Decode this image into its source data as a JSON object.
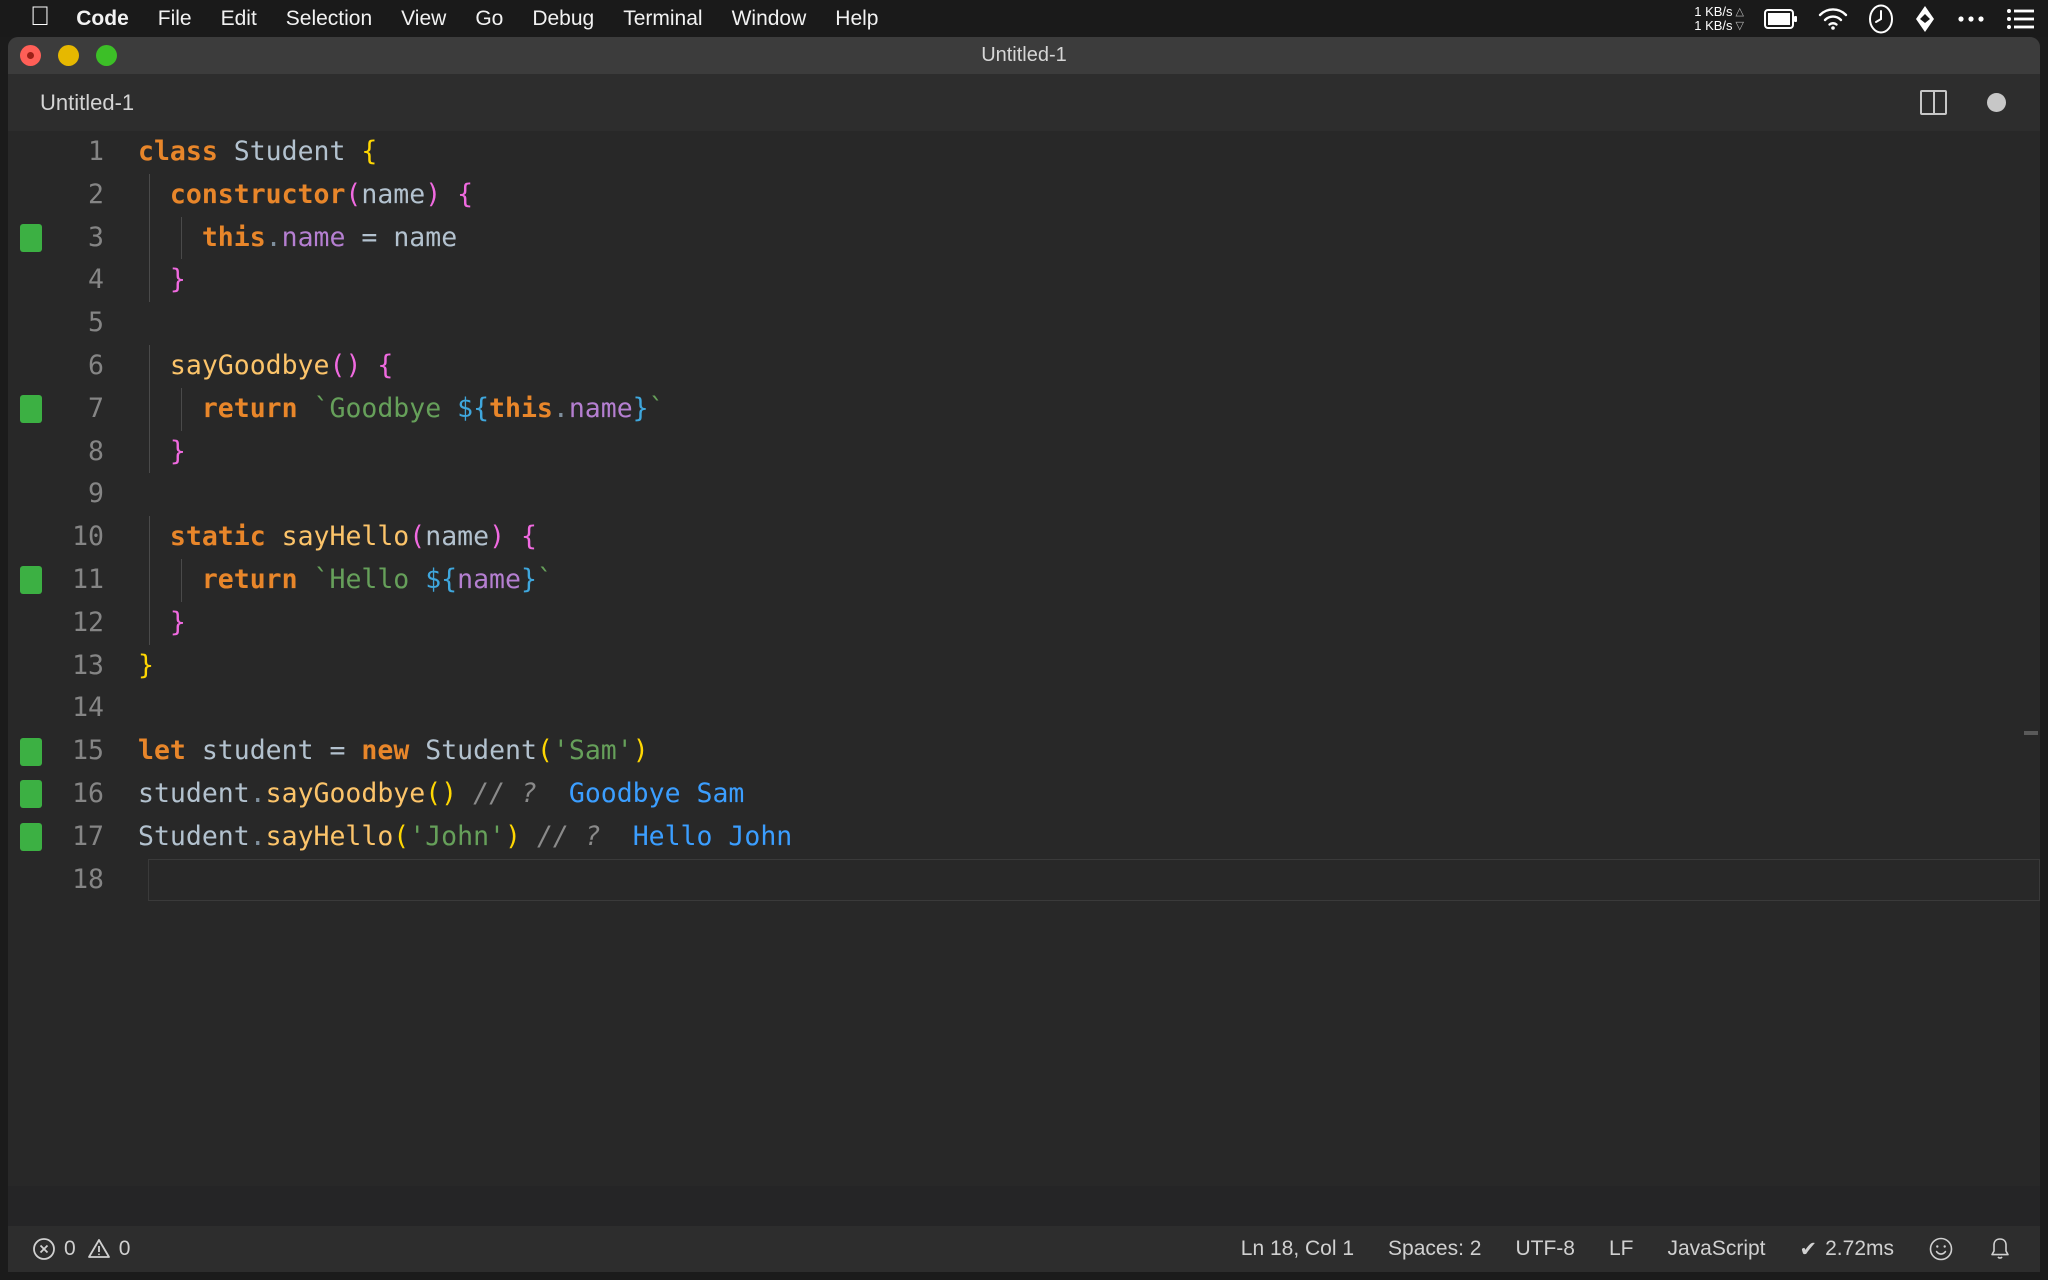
{
  "menubar": {
    "apple_icon": "apple-logo-icon",
    "items": [
      {
        "label": "Code",
        "bold": true
      },
      {
        "label": "File",
        "bold": false
      },
      {
        "label": "Edit",
        "bold": false
      },
      {
        "label": "Selection",
        "bold": false
      },
      {
        "label": "View",
        "bold": false
      },
      {
        "label": "Go",
        "bold": false
      },
      {
        "label": "Debug",
        "bold": false
      },
      {
        "label": "Terminal",
        "bold": false
      },
      {
        "label": "Window",
        "bold": false
      },
      {
        "label": "Help",
        "bold": false
      }
    ],
    "status": {
      "net_up": "1 KB/s",
      "net_down": "1 KB/s",
      "up_arrow": "△",
      "down_arrow": "▽",
      "icons": [
        "battery-icon",
        "wifi-icon",
        "clock-icon",
        "dropbox-icon",
        "control-center-icon",
        "list-icon"
      ]
    }
  },
  "window": {
    "title": "Untitled-1",
    "traffic_lights": [
      "close-button",
      "minimize-button",
      "zoom-button"
    ]
  },
  "tab": {
    "label": "Untitled-1",
    "split_icon": "split-editor-icon",
    "dirty_icon": "unsaved-changes-dot"
  },
  "editor": {
    "lines": [
      {
        "n": "1",
        "git": false,
        "indent": 0,
        "tokens": [
          {
            "t": "class",
            "c": "kw"
          },
          {
            "t": " ",
            "c": "op"
          },
          {
            "t": "Student",
            "c": "ident"
          },
          {
            "t": " ",
            "c": "op"
          },
          {
            "t": "{",
            "c": "br-y"
          }
        ]
      },
      {
        "n": "2",
        "git": false,
        "indent": 1,
        "tokens": [
          {
            "t": "  ",
            "c": "op"
          },
          {
            "t": "constructor",
            "c": "kw"
          },
          {
            "t": "(",
            "c": "br-p"
          },
          {
            "t": "name",
            "c": "ident"
          },
          {
            "t": ")",
            "c": "br-p"
          },
          {
            "t": " ",
            "c": "op"
          },
          {
            "t": "{",
            "c": "br-p"
          }
        ]
      },
      {
        "n": "3",
        "git": true,
        "indent": 2,
        "tokens": [
          {
            "t": "    ",
            "c": "op"
          },
          {
            "t": "this",
            "c": "kw"
          },
          {
            "t": ".",
            "c": "dot"
          },
          {
            "t": "name",
            "c": "prop"
          },
          {
            "t": " = ",
            "c": "op"
          },
          {
            "t": "name",
            "c": "ident"
          }
        ]
      },
      {
        "n": "4",
        "git": false,
        "indent": 1,
        "tokens": [
          {
            "t": "  ",
            "c": "op"
          },
          {
            "t": "}",
            "c": "br-p"
          }
        ]
      },
      {
        "n": "5",
        "git": false,
        "indent": 0,
        "tokens": []
      },
      {
        "n": "6",
        "git": false,
        "indent": 1,
        "tokens": [
          {
            "t": "  ",
            "c": "op"
          },
          {
            "t": "sayGoodbye",
            "c": "fn"
          },
          {
            "t": "(",
            "c": "br-p"
          },
          {
            "t": ")",
            "c": "br-p"
          },
          {
            "t": " ",
            "c": "op"
          },
          {
            "t": "{",
            "c": "br-p"
          }
        ]
      },
      {
        "n": "7",
        "git": true,
        "indent": 2,
        "tokens": [
          {
            "t": "    ",
            "c": "op"
          },
          {
            "t": "return",
            "c": "kw"
          },
          {
            "t": " ",
            "c": "op"
          },
          {
            "t": "`Goodbye ",
            "c": "tpl"
          },
          {
            "t": "${",
            "c": "interp"
          },
          {
            "t": "this",
            "c": "kw"
          },
          {
            "t": ".",
            "c": "dot"
          },
          {
            "t": "name",
            "c": "prop"
          },
          {
            "t": "}",
            "c": "interp"
          },
          {
            "t": "`",
            "c": "tpl"
          }
        ]
      },
      {
        "n": "8",
        "git": false,
        "indent": 1,
        "tokens": [
          {
            "t": "  ",
            "c": "op"
          },
          {
            "t": "}",
            "c": "br-p"
          }
        ]
      },
      {
        "n": "9",
        "git": false,
        "indent": 0,
        "tokens": []
      },
      {
        "n": "10",
        "git": false,
        "indent": 1,
        "tokens": [
          {
            "t": "  ",
            "c": "op"
          },
          {
            "t": "static",
            "c": "kw"
          },
          {
            "t": " ",
            "c": "op"
          },
          {
            "t": "sayHello",
            "c": "fn"
          },
          {
            "t": "(",
            "c": "br-p"
          },
          {
            "t": "name",
            "c": "ident"
          },
          {
            "t": ")",
            "c": "br-p"
          },
          {
            "t": " ",
            "c": "op"
          },
          {
            "t": "{",
            "c": "br-p"
          }
        ]
      },
      {
        "n": "11",
        "git": true,
        "indent": 2,
        "tokens": [
          {
            "t": "    ",
            "c": "op"
          },
          {
            "t": "return",
            "c": "kw"
          },
          {
            "t": " ",
            "c": "op"
          },
          {
            "t": "`Hello ",
            "c": "tpl"
          },
          {
            "t": "${",
            "c": "interp"
          },
          {
            "t": "name",
            "c": "prop"
          },
          {
            "t": "}",
            "c": "interp"
          },
          {
            "t": "`",
            "c": "tpl"
          }
        ]
      },
      {
        "n": "12",
        "git": false,
        "indent": 1,
        "tokens": [
          {
            "t": "  ",
            "c": "op"
          },
          {
            "t": "}",
            "c": "br-p"
          }
        ]
      },
      {
        "n": "13",
        "git": false,
        "indent": 0,
        "tokens": [
          {
            "t": "}",
            "c": "br-y"
          }
        ]
      },
      {
        "n": "14",
        "git": false,
        "indent": 0,
        "tokens": []
      },
      {
        "n": "15",
        "git": true,
        "indent": 0,
        "tokens": [
          {
            "t": "let",
            "c": "kw"
          },
          {
            "t": " ",
            "c": "op"
          },
          {
            "t": "student",
            "c": "ident"
          },
          {
            "t": " = ",
            "c": "op"
          },
          {
            "t": "new",
            "c": "kw"
          },
          {
            "t": " ",
            "c": "op"
          },
          {
            "t": "Student",
            "c": "ident"
          },
          {
            "t": "(",
            "c": "br-y"
          },
          {
            "t": "'Sam'",
            "c": "str"
          },
          {
            "t": ")",
            "c": "br-y"
          }
        ]
      },
      {
        "n": "16",
        "git": true,
        "indent": 0,
        "tokens": [
          {
            "t": "student",
            "c": "ident"
          },
          {
            "t": ".",
            "c": "dot"
          },
          {
            "t": "sayGoodbye",
            "c": "fn"
          },
          {
            "t": "(",
            "c": "br-y"
          },
          {
            "t": ")",
            "c": "br-y"
          },
          {
            "t": " ",
            "c": "op"
          },
          {
            "t": "// ?",
            "c": "comment"
          },
          {
            "t": "  ",
            "c": "op"
          },
          {
            "t": "Goodbye Sam",
            "c": "result"
          }
        ]
      },
      {
        "n": "17",
        "git": true,
        "indent": 0,
        "tokens": [
          {
            "t": "Student",
            "c": "ident"
          },
          {
            "t": ".",
            "c": "dot"
          },
          {
            "t": "sayHello",
            "c": "fn"
          },
          {
            "t": "(",
            "c": "br-y"
          },
          {
            "t": "'John'",
            "c": "str"
          },
          {
            "t": ")",
            "c": "br-y"
          },
          {
            "t": " ",
            "c": "op"
          },
          {
            "t": "// ?",
            "c": "comment"
          },
          {
            "t": "  ",
            "c": "op"
          },
          {
            "t": "Hello John",
            "c": "result"
          }
        ]
      },
      {
        "n": "18",
        "git": false,
        "indent": 0,
        "tokens": [],
        "cursor": true
      }
    ]
  },
  "statusbar": {
    "errors_icon": "error-circle-icon",
    "errors": "0",
    "warnings_icon": "warning-triangle-icon",
    "warnings": "0",
    "position": "Ln 18, Col 1",
    "indentation": "Spaces: 2",
    "encoding": "UTF-8",
    "eol": "LF",
    "language": "JavaScript",
    "runtime_check": "✔",
    "runtime": "2.72ms",
    "feedback_icon": "smiley-icon",
    "notifications_icon": "bell-icon"
  }
}
